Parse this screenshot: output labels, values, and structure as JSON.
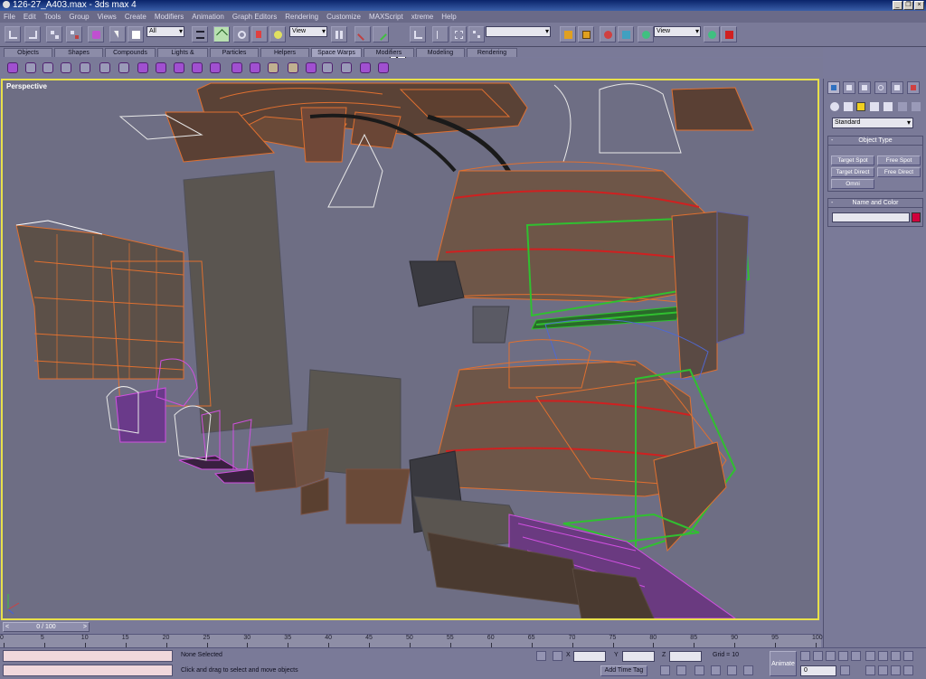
{
  "window": {
    "title": "126-27_A403.max - 3ds max 4",
    "minimize": "_",
    "restore": "❐",
    "close": "×"
  },
  "menu": [
    "File",
    "Edit",
    "Tools",
    "Group",
    "Views",
    "Create",
    "Modifiers",
    "Animation",
    "Graph Editors",
    "Rendering",
    "Customize",
    "MAXScript",
    "xtreme",
    "Help"
  ],
  "toolbar": {
    "selection_filter": "All",
    "ref_coord_1": "View",
    "ref_coord_2": "View",
    "z_label": "Z",
    "named_selection": ""
  },
  "tabs": [
    "Objects",
    "Shapes",
    "Compounds",
    "Lights & Cameras",
    "Particles",
    "Helpers",
    "Space Warps",
    "Modifiers",
    "Modeling",
    "Rendering"
  ],
  "active_tab": "Space Warps",
  "viewport": {
    "label": "Perspective"
  },
  "command_panel": {
    "category": "Standard",
    "object_type_header": "Object Type",
    "buttons": [
      "Target Spot",
      "Free Spot",
      "Target Direct",
      "Free Direct",
      "Omni"
    ],
    "name_color_header": "Name and Color",
    "object_name": ""
  },
  "time": {
    "frame_display": "0 / 100",
    "ticks": [
      "0",
      "5",
      "10",
      "15",
      "20",
      "25",
      "30",
      "35",
      "40",
      "45",
      "50",
      "55",
      "60",
      "65",
      "70",
      "75",
      "80",
      "85",
      "90",
      "95",
      "100"
    ]
  },
  "status": {
    "selection": "None Selected",
    "prompt": "Click and drag to select and move objects",
    "x_label": "X",
    "y_label": "Y",
    "z_label": "Z",
    "x_value": "",
    "y_value": "",
    "z_value": "",
    "grid": "Grid = 10",
    "add_time_tag": "Add Time Tag",
    "animate": "Animate",
    "current_frame": "0"
  },
  "colors": {
    "viewport_border": "#e8e04a",
    "wire_orange": "#e06a28",
    "wire_green": "#30c030",
    "wire_magenta": "#c040e0",
    "wire_blue": "#5068d0",
    "object_color": "#d0003c"
  }
}
